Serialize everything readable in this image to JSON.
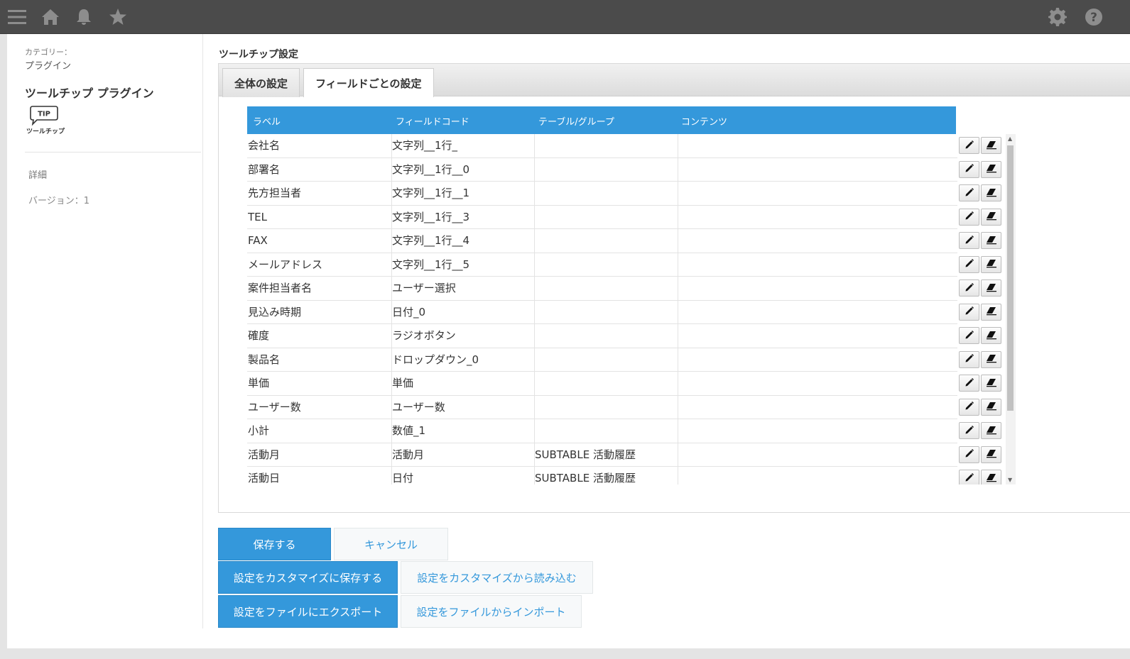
{
  "topbar": {
    "icons": [
      "menu-icon",
      "home-icon",
      "bell-icon",
      "star-icon",
      "gear-icon",
      "help-icon"
    ]
  },
  "sidebar": {
    "category_label": "カテゴリー：",
    "category_value": "プラグイン",
    "plugin_name": "ツールチップ プラグイン",
    "logo_tip": "TIP",
    "logo_caption": "ツールチップ",
    "details_link": "詳細",
    "version": "バージョン：1"
  },
  "main": {
    "title": "ツールチップ設定",
    "tabs": [
      {
        "label": "全体の設定",
        "active": false
      },
      {
        "label": "フィールドごとの設定",
        "active": true
      }
    ],
    "table": {
      "headers": [
        "ラベル",
        "フィールドコード",
        "テーブル/グループ",
        "コンテンツ"
      ],
      "rows": [
        {
          "label": "会社名",
          "code": "文字列__1行_",
          "group": "",
          "content": ""
        },
        {
          "label": "部署名",
          "code": "文字列__1行__0",
          "group": "",
          "content": ""
        },
        {
          "label": "先方担当者",
          "code": "文字列__1行__1",
          "group": "",
          "content": ""
        },
        {
          "label": "TEL",
          "code": "文字列__1行__3",
          "group": "",
          "content": ""
        },
        {
          "label": "FAX",
          "code": "文字列__1行__4",
          "group": "",
          "content": ""
        },
        {
          "label": "メールアドレス",
          "code": "文字列__1行__5",
          "group": "",
          "content": ""
        },
        {
          "label": "案件担当者名",
          "code": "ユーザー選択",
          "group": "",
          "content": ""
        },
        {
          "label": "見込み時期",
          "code": "日付_0",
          "group": "",
          "content": ""
        },
        {
          "label": "確度",
          "code": "ラジオボタン",
          "group": "",
          "content": ""
        },
        {
          "label": "製品名",
          "code": "ドロップダウン_0",
          "group": "",
          "content": ""
        },
        {
          "label": "単価",
          "code": "単価",
          "group": "",
          "content": ""
        },
        {
          "label": "ユーザー数",
          "code": "ユーザー数",
          "group": "",
          "content": ""
        },
        {
          "label": "小計",
          "code": "数値_1",
          "group": "",
          "content": ""
        },
        {
          "label": "活動月",
          "code": "活動月",
          "group": "SUBTABLE 活動履歴",
          "content": ""
        },
        {
          "label": "活動日",
          "code": "日付",
          "group": "SUBTABLE 活動履歴",
          "content": ""
        }
      ]
    }
  },
  "actions": {
    "save": "保存する",
    "cancel": "キャンセル",
    "save_to_customize": "設定をカスタマイズに保存する",
    "load_from_customize": "設定をカスタマイズから読み込む",
    "export_to_file": "設定をファイルにエクスポート",
    "import_from_file": "設定をファイルからインポート"
  },
  "colors": {
    "topbar": "#4b4b4b",
    "accent": "#3498db",
    "icon": "#8d8d8d"
  }
}
